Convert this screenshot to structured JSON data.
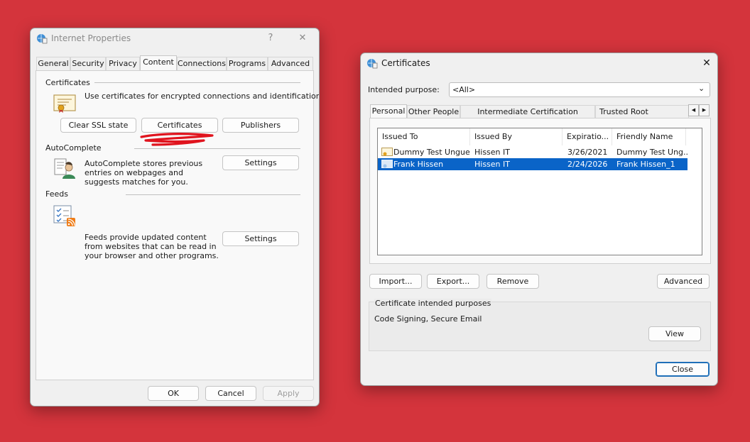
{
  "internet_properties": {
    "title": "Internet Properties",
    "help": "?",
    "close": "✕",
    "tabs": [
      "General",
      "Security",
      "Privacy",
      "Content",
      "Connections",
      "Programs",
      "Advanced"
    ],
    "active_tab": "Content",
    "certificates": {
      "heading": "Certificates",
      "description": "Use certificates for encrypted connections and identification.",
      "clear_ssl": "Clear SSL state",
      "certificates_btn": "Certificates",
      "publishers": "Publishers"
    },
    "autocomplete": {
      "heading": "AutoComplete",
      "description": "AutoComplete stores previous entries on webpages and suggests matches for you.",
      "settings": "Settings"
    },
    "feeds": {
      "heading": "Feeds",
      "description": "Feeds provide updated content from websites that can be read in your browser and other programs.",
      "settings": "Settings"
    },
    "footer": {
      "ok": "OK",
      "cancel": "Cancel",
      "apply": "Apply"
    }
  },
  "certificates_dialog": {
    "title": "Certificates",
    "close": "✕",
    "intended_purpose_label": "Intended purpose:",
    "intended_purpose_value": "<All>",
    "tabs": [
      "Personal",
      "Other People",
      "Intermediate Certification Authorities",
      "Trusted Root Certification"
    ],
    "active_tab": "Personal",
    "columns": [
      "Issued To",
      "Issued By",
      "Expiratio...",
      "Friendly Name"
    ],
    "rows": [
      {
        "issued_to": "Dummy Test Ungue...",
        "issued_by": "Hissen IT",
        "expiration": "3/26/2021",
        "friendly_name": "Dummy Test Ung...",
        "selected": false
      },
      {
        "issued_to": "Frank Hissen",
        "issued_by": "Hissen IT",
        "expiration": "2/24/2026",
        "friendly_name": "Frank Hissen_1",
        "selected": true
      }
    ],
    "buttons": {
      "import": "Import...",
      "export": "Export...",
      "remove": "Remove",
      "advanced": "Advanced"
    },
    "purposes_group_label": "Certificate intended purposes",
    "purposes_value": "Code Signing, Secure Email",
    "view": "View",
    "close_btn": "Close"
  },
  "colors": {
    "background": "#d4343c",
    "selection": "#0a64c8",
    "annotation": "#e0141e"
  }
}
